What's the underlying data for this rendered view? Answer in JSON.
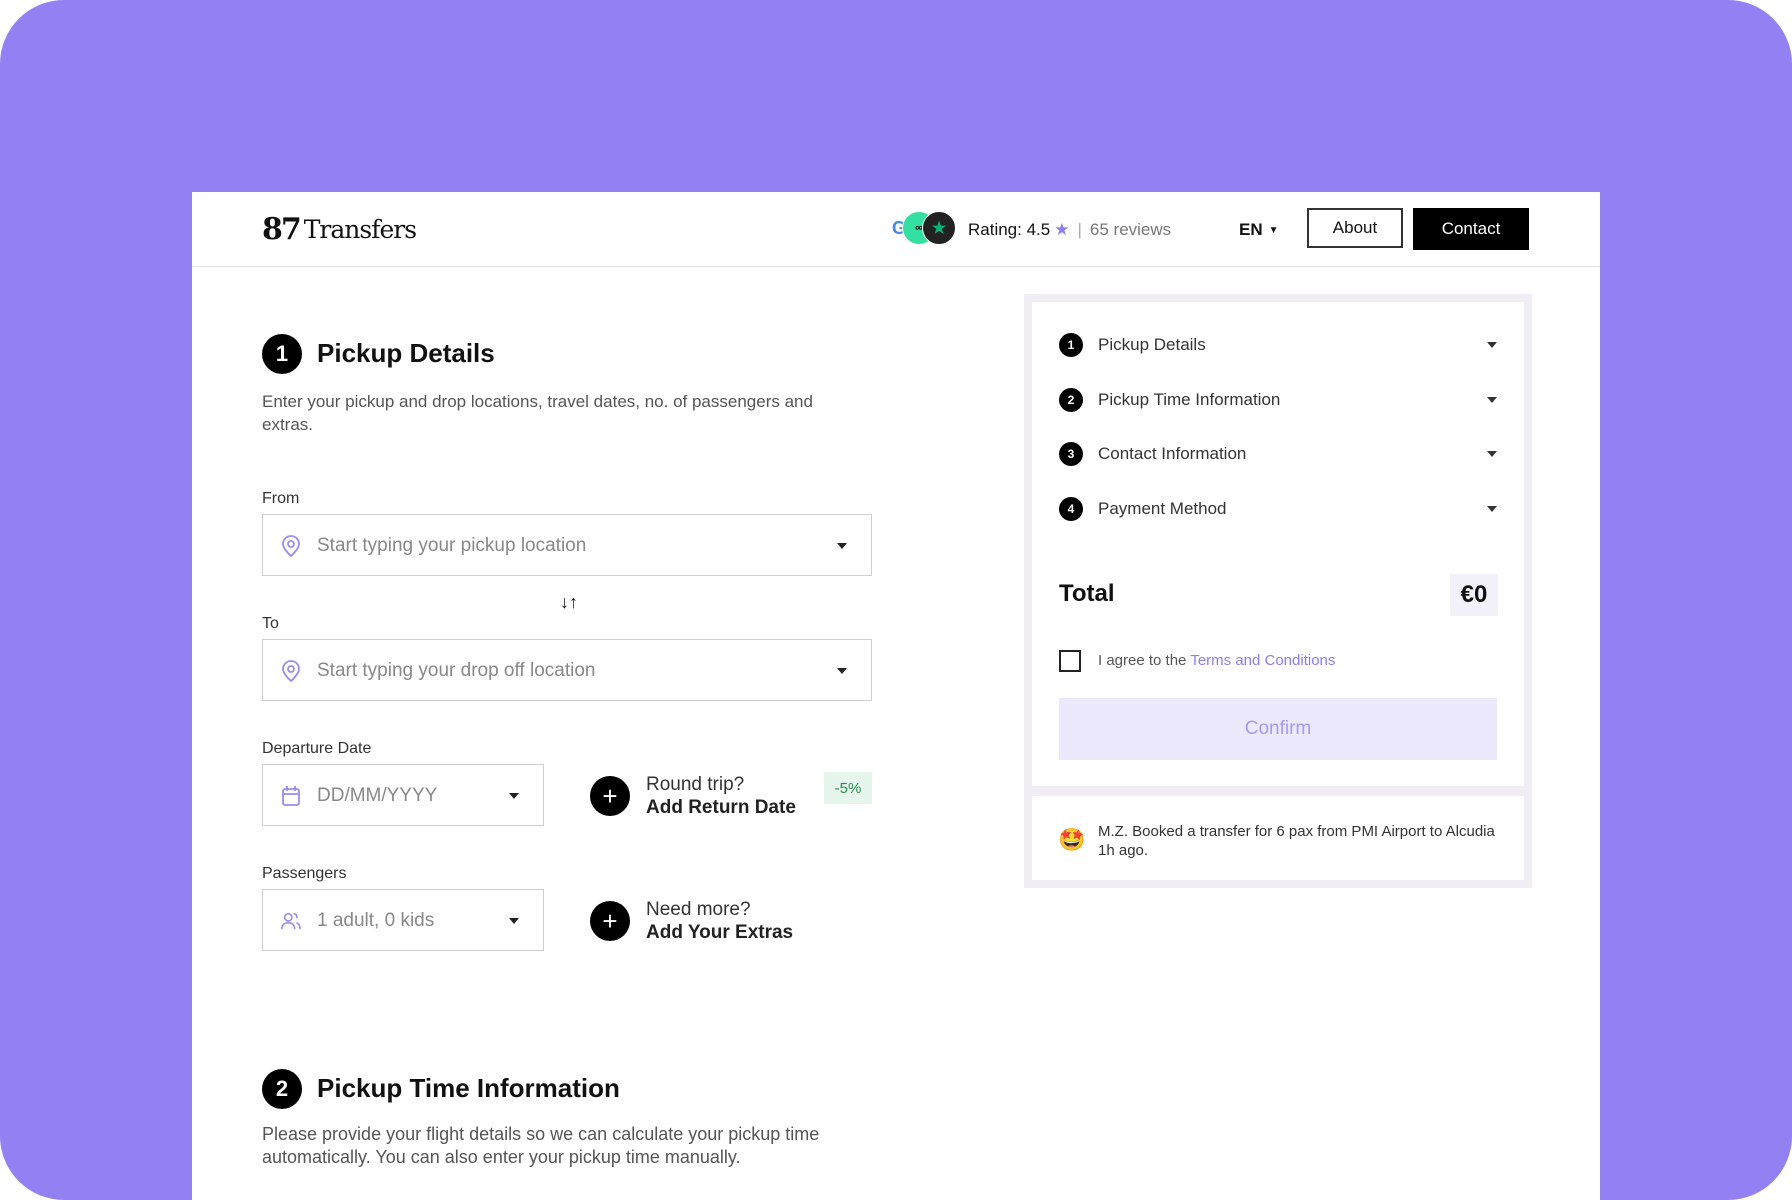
{
  "header": {
    "logo_mark": "87",
    "logo_text": "Transfers",
    "badge_g": "G",
    "badge_t": "∞",
    "badge_s": "★",
    "rating_label": "Rating: 4.5",
    "rating_star": "★",
    "rating_sep": "|",
    "reviews": "65 reviews",
    "language": "EN",
    "about_label": "About",
    "contact_label": "Contact"
  },
  "pickup": {
    "step_number": "1",
    "title": "Pickup Details",
    "description": "Enter your pickup and drop locations, travel dates, no. of passengers and extras.",
    "from_label": "From",
    "from_placeholder": "Start typing your pickup location",
    "to_label": "To",
    "to_placeholder": "Start typing your drop off location",
    "swap_icon": "↓↑",
    "departure_label": "Departure Date",
    "departure_placeholder": "DD/MM/YYYY",
    "passengers_label": "Passengers",
    "passengers_value": "1 adult, 0 kids",
    "round_trip_question": "Round trip?",
    "round_trip_action": "Add Return Date",
    "round_trip_discount": "-5%",
    "extras_question": "Need more?",
    "extras_action": "Add Your Extras",
    "plus_symbol": "+"
  },
  "time_info": {
    "step_number": "2",
    "title": "Pickup Time Information",
    "description": "Please provide your flight details so we can calculate your pickup time automatically. You can also enter your pickup time manually."
  },
  "summary": {
    "steps": [
      {
        "num": "1",
        "label": "Pickup Details"
      },
      {
        "num": "2",
        "label": "Pickup Time Information"
      },
      {
        "num": "3",
        "label": "Contact Information"
      },
      {
        "num": "4",
        "label": "Payment Method"
      }
    ],
    "total_label": "Total",
    "total_value": "€0",
    "agree_prefix": "I agree to the",
    "agree_link": "Terms and Conditions",
    "confirm_label": "Confirm"
  },
  "feed": {
    "emoji": "🤩",
    "text": "M.Z. Booked a transfer for 6 pax from PMI Airport to Alcudia 1h ago."
  },
  "colors": {
    "background": "#9381f3",
    "accent": "#8c7df0",
    "confirm_bg": "#ece9fd",
    "discount_bg": "#e6f6ec",
    "discount_text": "#2e8b57"
  }
}
